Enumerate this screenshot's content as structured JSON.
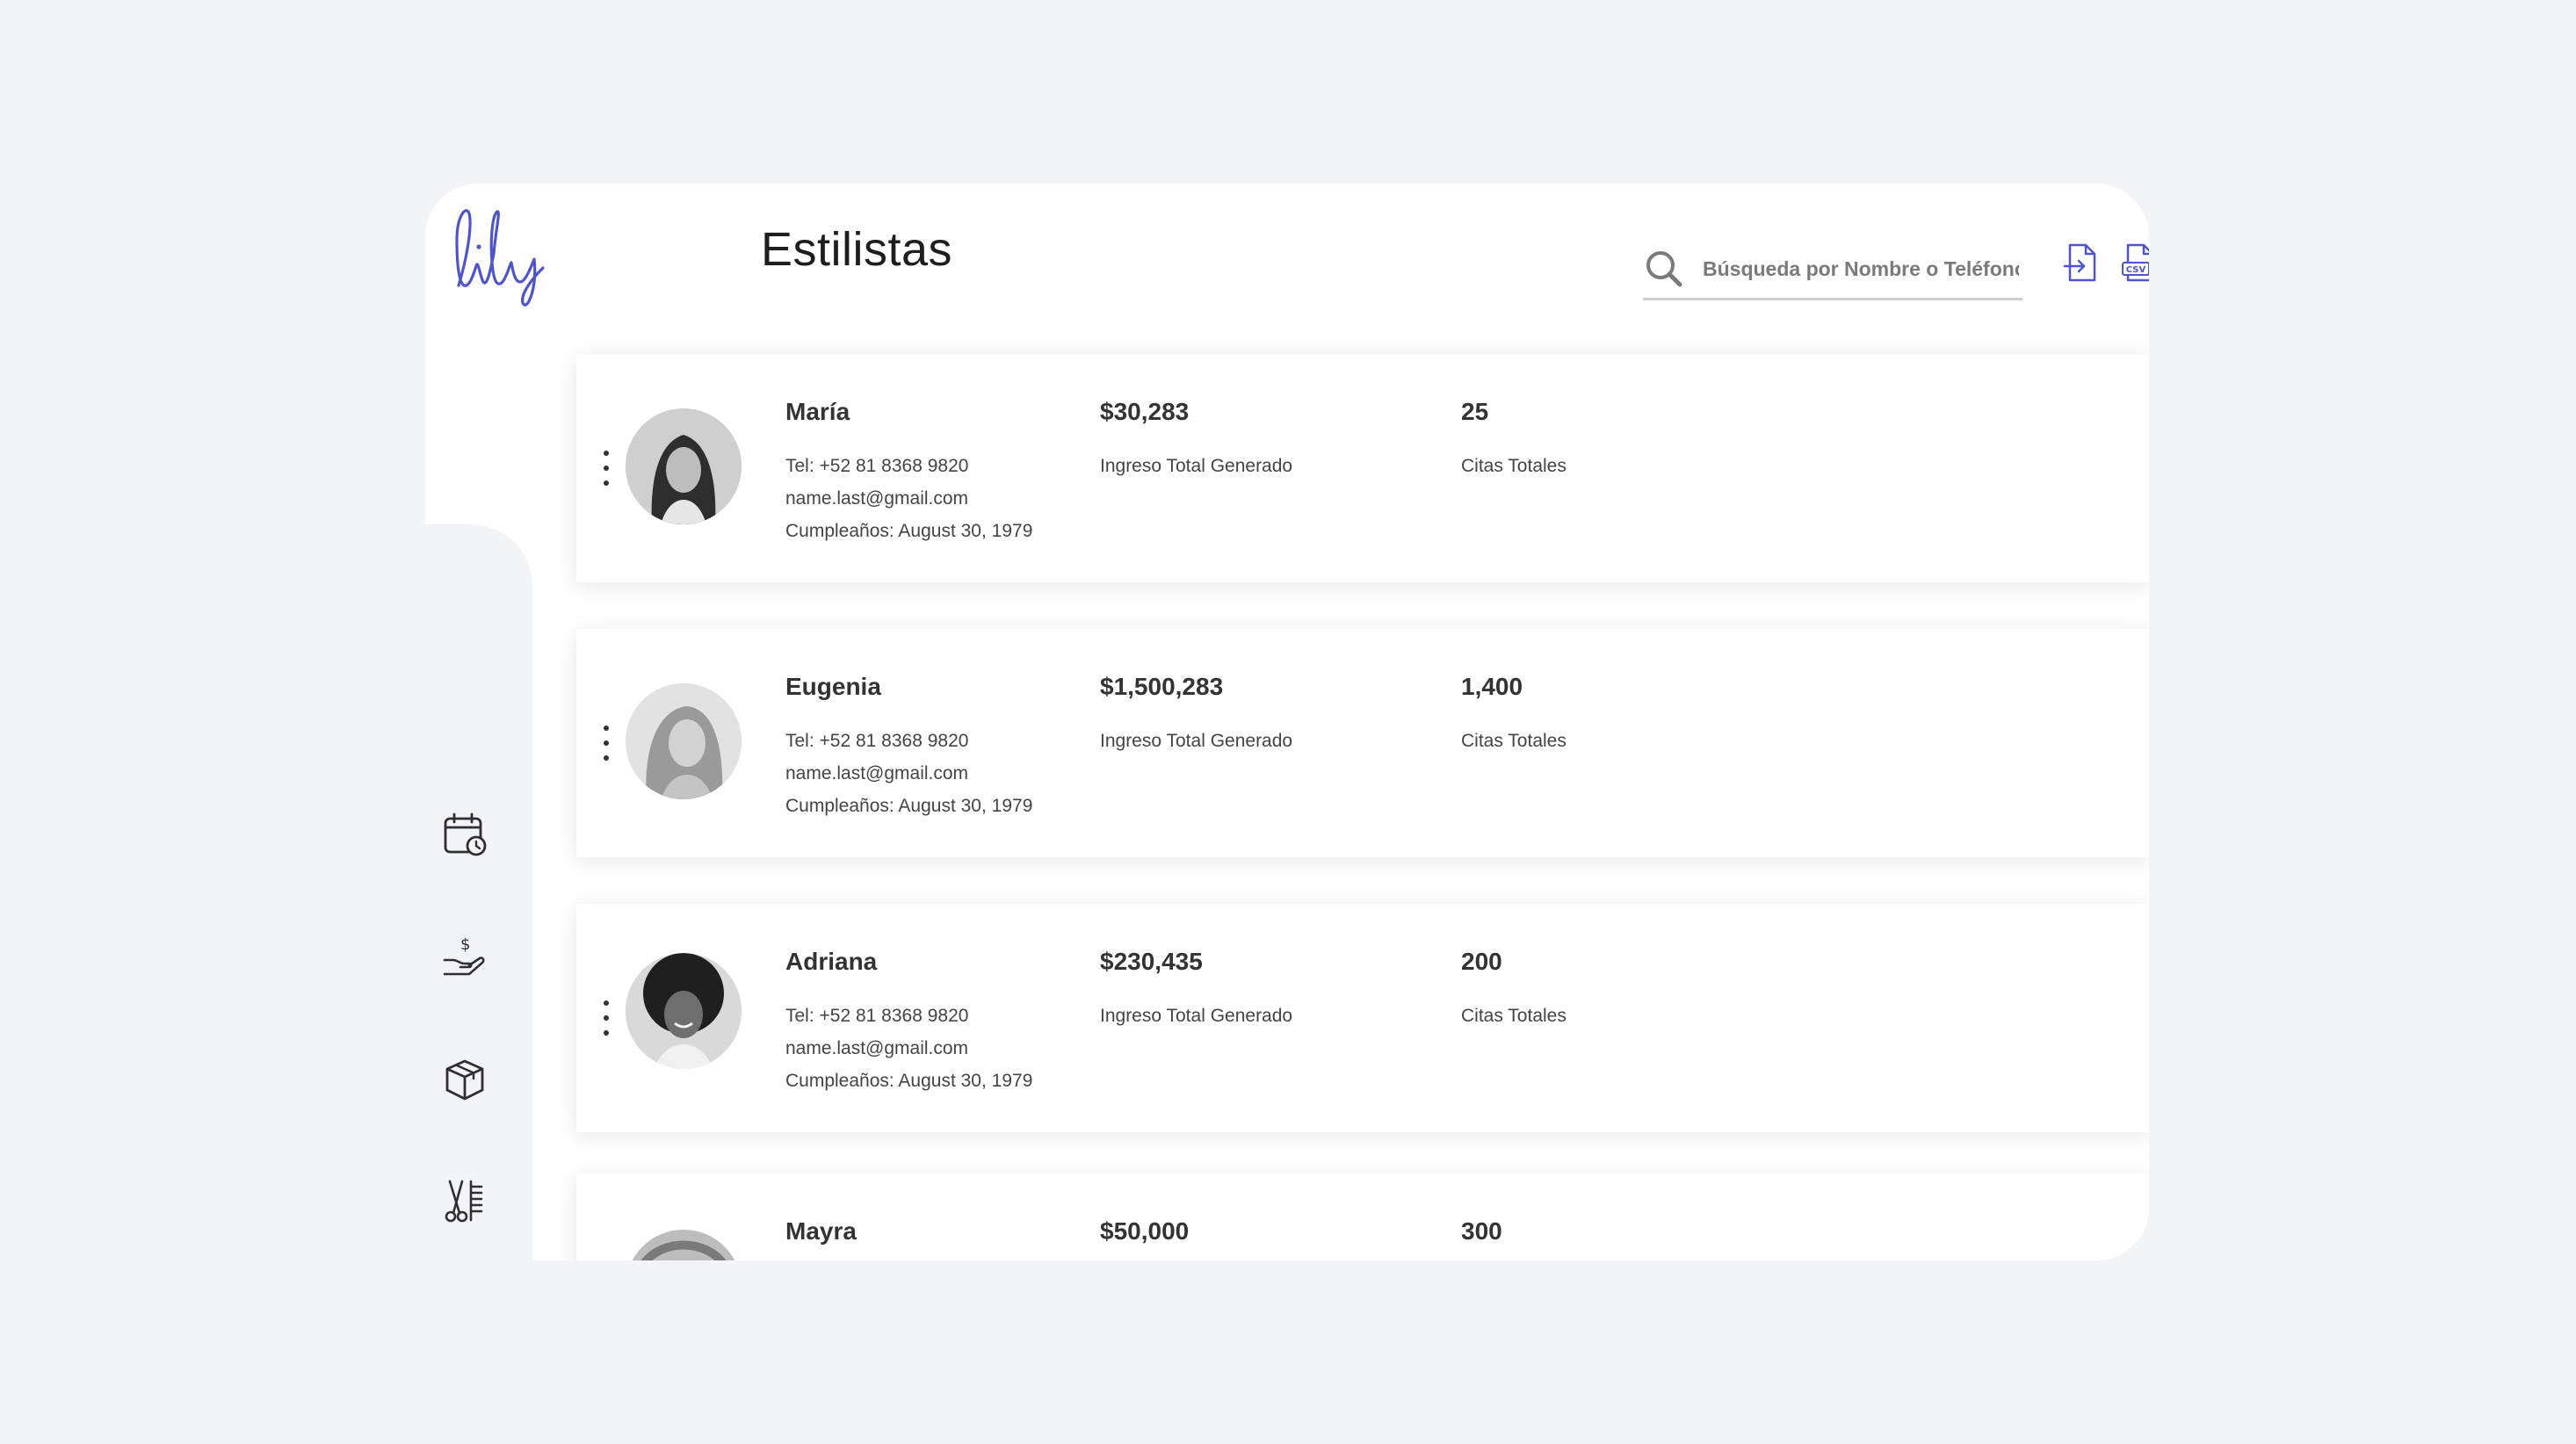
{
  "app": {
    "logo_text": "lily",
    "brand_color": "#4f55c9"
  },
  "header": {
    "title": "Estilistas",
    "search_placeholder": "Búsqueda por Nombre o Teléfono",
    "export_icon": "file-export-icon",
    "csv_icon": "csv-file-icon",
    "csv_label": "CSV"
  },
  "sidebar": {
    "items": [
      {
        "icon": "calendar-clock-icon"
      },
      {
        "icon": "hand-money-icon"
      },
      {
        "icon": "box-icon"
      },
      {
        "icon": "scissors-comb-icon"
      },
      {
        "icon": "user-icon"
      },
      {
        "icon": "bar-chart-icon"
      }
    ]
  },
  "stylists": [
    {
      "name": "María",
      "phone": "Tel: +52 81 8368 9820",
      "email": "name.last@gmail.com",
      "birthday": "Cumpleaños: August 30, 1979",
      "revenue": "$30,283",
      "revenue_label": "Ingreso Total Generado",
      "appointments": "25",
      "appointments_label": "Citas Totales"
    },
    {
      "name": "Eugenia",
      "phone": "Tel: +52 81 8368 9820",
      "email": "name.last@gmail.com",
      "birthday": "Cumpleaños: August 30, 1979",
      "revenue": "$1,500,283",
      "revenue_label": "Ingreso Total Generado",
      "appointments": "1,400",
      "appointments_label": "Citas Totales"
    },
    {
      "name": "Adriana",
      "phone": "Tel: +52 81 8368 9820",
      "email": "name.last@gmail.com",
      "birthday": "Cumpleaños: August 30, 1979",
      "revenue": "$230,435",
      "revenue_label": "Ingreso Total Generado",
      "appointments": "200",
      "appointments_label": "Citas Totales"
    },
    {
      "name": "Mayra",
      "revenue": "$50,000",
      "appointments": "300"
    }
  ]
}
